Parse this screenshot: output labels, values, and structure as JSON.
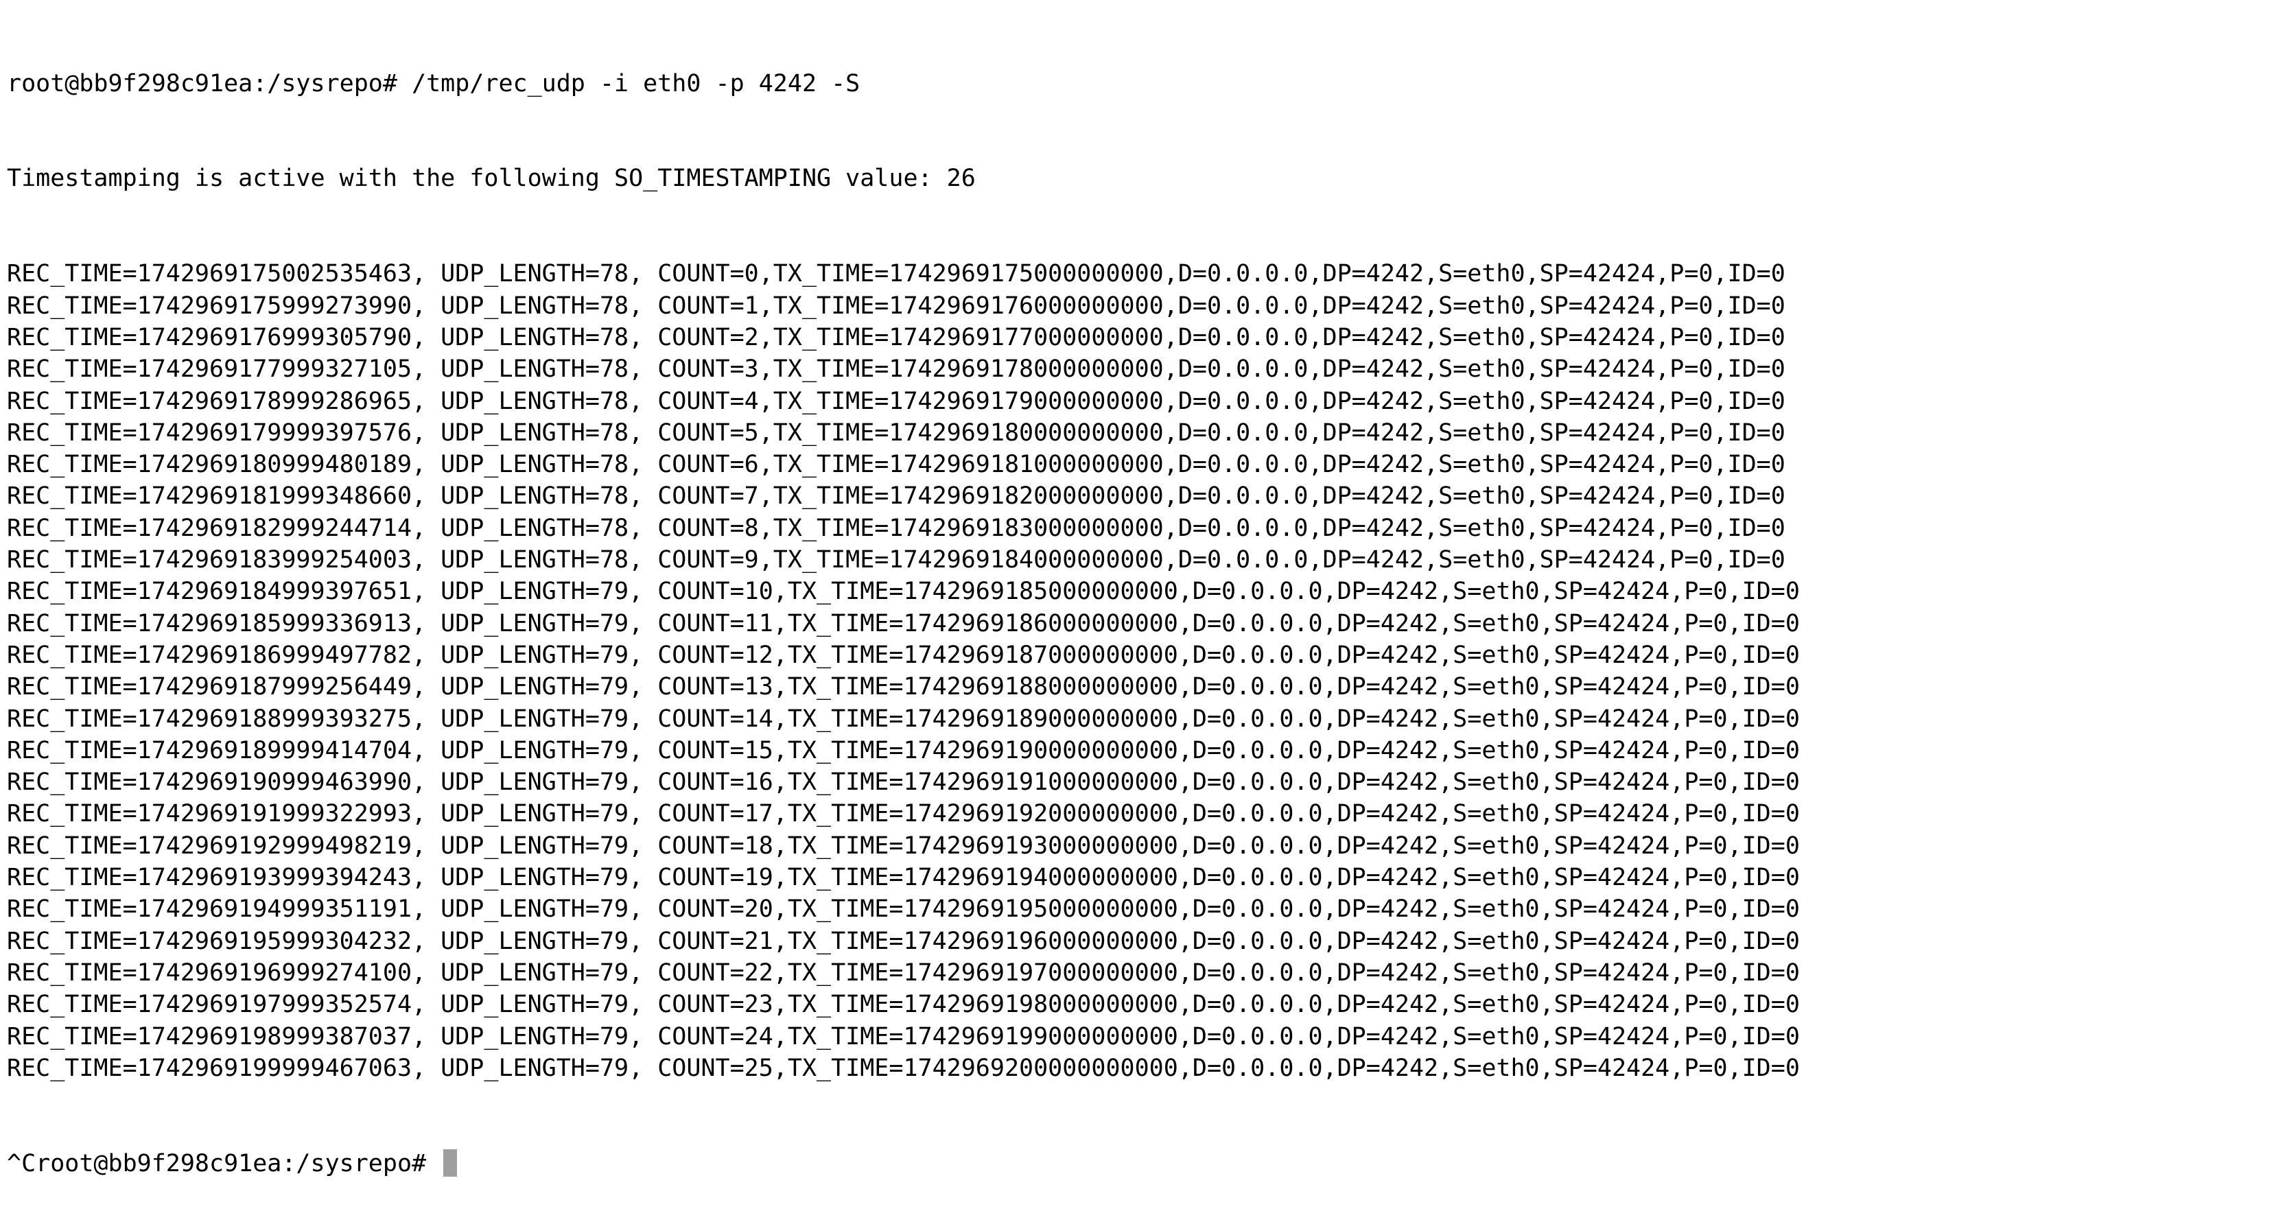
{
  "terminal": {
    "command_line": "root@bb9f298c91ea:/sysrepo# /tmp/rec_udp -i eth0 -p 4242 -S",
    "info_line": "Timestamping is active with the following SO_TIMESTAMPING value: 26",
    "output_lines": [
      "REC_TIME=1742969175002535463, UDP_LENGTH=78, COUNT=0,TX_TIME=1742969175000000000,D=0.0.0.0,DP=4242,S=eth0,SP=42424,P=0,ID=0",
      "REC_TIME=1742969175999273990, UDP_LENGTH=78, COUNT=1,TX_TIME=1742969176000000000,D=0.0.0.0,DP=4242,S=eth0,SP=42424,P=0,ID=0",
      "REC_TIME=1742969176999305790, UDP_LENGTH=78, COUNT=2,TX_TIME=1742969177000000000,D=0.0.0.0,DP=4242,S=eth0,SP=42424,P=0,ID=0",
      "REC_TIME=1742969177999327105, UDP_LENGTH=78, COUNT=3,TX_TIME=1742969178000000000,D=0.0.0.0,DP=4242,S=eth0,SP=42424,P=0,ID=0",
      "REC_TIME=1742969178999286965, UDP_LENGTH=78, COUNT=4,TX_TIME=1742969179000000000,D=0.0.0.0,DP=4242,S=eth0,SP=42424,P=0,ID=0",
      "REC_TIME=1742969179999397576, UDP_LENGTH=78, COUNT=5,TX_TIME=1742969180000000000,D=0.0.0.0,DP=4242,S=eth0,SP=42424,P=0,ID=0",
      "REC_TIME=1742969180999480189, UDP_LENGTH=78, COUNT=6,TX_TIME=1742969181000000000,D=0.0.0.0,DP=4242,S=eth0,SP=42424,P=0,ID=0",
      "REC_TIME=1742969181999348660, UDP_LENGTH=78, COUNT=7,TX_TIME=1742969182000000000,D=0.0.0.0,DP=4242,S=eth0,SP=42424,P=0,ID=0",
      "REC_TIME=1742969182999244714, UDP_LENGTH=78, COUNT=8,TX_TIME=1742969183000000000,D=0.0.0.0,DP=4242,S=eth0,SP=42424,P=0,ID=0",
      "REC_TIME=1742969183999254003, UDP_LENGTH=78, COUNT=9,TX_TIME=1742969184000000000,D=0.0.0.0,DP=4242,S=eth0,SP=42424,P=0,ID=0",
      "REC_TIME=1742969184999397651, UDP_LENGTH=79, COUNT=10,TX_TIME=1742969185000000000,D=0.0.0.0,DP=4242,S=eth0,SP=42424,P=0,ID=0",
      "REC_TIME=1742969185999336913, UDP_LENGTH=79, COUNT=11,TX_TIME=1742969186000000000,D=0.0.0.0,DP=4242,S=eth0,SP=42424,P=0,ID=0",
      "REC_TIME=1742969186999497782, UDP_LENGTH=79, COUNT=12,TX_TIME=1742969187000000000,D=0.0.0.0,DP=4242,S=eth0,SP=42424,P=0,ID=0",
      "REC_TIME=1742969187999256449, UDP_LENGTH=79, COUNT=13,TX_TIME=1742969188000000000,D=0.0.0.0,DP=4242,S=eth0,SP=42424,P=0,ID=0",
      "REC_TIME=1742969188999393275, UDP_LENGTH=79, COUNT=14,TX_TIME=1742969189000000000,D=0.0.0.0,DP=4242,S=eth0,SP=42424,P=0,ID=0",
      "REC_TIME=1742969189999414704, UDP_LENGTH=79, COUNT=15,TX_TIME=1742969190000000000,D=0.0.0.0,DP=4242,S=eth0,SP=42424,P=0,ID=0",
      "REC_TIME=1742969190999463990, UDP_LENGTH=79, COUNT=16,TX_TIME=1742969191000000000,D=0.0.0.0,DP=4242,S=eth0,SP=42424,P=0,ID=0",
      "REC_TIME=1742969191999322993, UDP_LENGTH=79, COUNT=17,TX_TIME=1742969192000000000,D=0.0.0.0,DP=4242,S=eth0,SP=42424,P=0,ID=0",
      "REC_TIME=1742969192999498219, UDP_LENGTH=79, COUNT=18,TX_TIME=1742969193000000000,D=0.0.0.0,DP=4242,S=eth0,SP=42424,P=0,ID=0",
      "REC_TIME=1742969193999394243, UDP_LENGTH=79, COUNT=19,TX_TIME=1742969194000000000,D=0.0.0.0,DP=4242,S=eth0,SP=42424,P=0,ID=0",
      "REC_TIME=1742969194999351191, UDP_LENGTH=79, COUNT=20,TX_TIME=1742969195000000000,D=0.0.0.0,DP=4242,S=eth0,SP=42424,P=0,ID=0",
      "REC_TIME=1742969195999304232, UDP_LENGTH=79, COUNT=21,TX_TIME=1742969196000000000,D=0.0.0.0,DP=4242,S=eth0,SP=42424,P=0,ID=0",
      "REC_TIME=1742969196999274100, UDP_LENGTH=79, COUNT=22,TX_TIME=1742969197000000000,D=0.0.0.0,DP=4242,S=eth0,SP=42424,P=0,ID=0",
      "REC_TIME=1742969197999352574, UDP_LENGTH=79, COUNT=23,TX_TIME=1742969198000000000,D=0.0.0.0,DP=4242,S=eth0,SP=42424,P=0,ID=0",
      "REC_TIME=1742969198999387037, UDP_LENGTH=79, COUNT=24,TX_TIME=1742969199000000000,D=0.0.0.0,DP=4242,S=eth0,SP=42424,P=0,ID=0",
      "REC_TIME=1742969199999467063, UDP_LENGTH=79, COUNT=25,TX_TIME=1742969200000000000,D=0.0.0.0,DP=4242,S=eth0,SP=42424,P=0,ID=0"
    ],
    "final_prompt": "^Croot@bb9f298c91ea:/sysrepo# ",
    "colors": {
      "background": "#ffffff",
      "text": "#000000",
      "cursor": "#9e9e9e"
    }
  }
}
